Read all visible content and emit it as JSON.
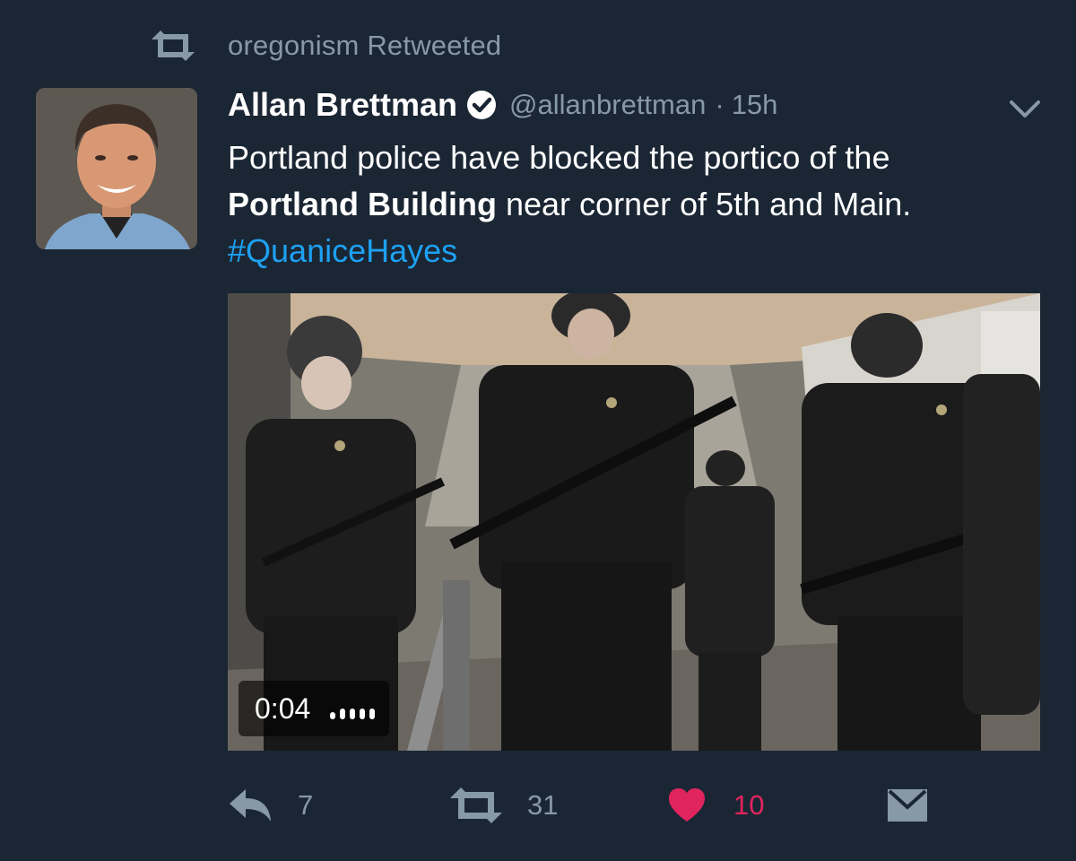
{
  "retweet_context": {
    "icon": "retweet-icon",
    "text": "oregonism Retweeted"
  },
  "author": {
    "avatar_alt": "Allan Brettman avatar",
    "display_name": "Allan Brettman",
    "verified_icon": "verified-badge-icon",
    "handle": "@allanbrettman",
    "separator": "·",
    "time": "15h"
  },
  "menu": {
    "icon": "chevron-down-icon"
  },
  "tweet": {
    "text_line1": "Portland police have blocked the portico of the",
    "text_bold": "Portland Building",
    "text_line2_rest": " near corner of 5th and Main.",
    "hashtag": "#QuaniceHayes"
  },
  "media": {
    "type": "video",
    "duration": "0:04",
    "signal_icon": "loading-dots-icon"
  },
  "actions": {
    "reply": {
      "icon": "reply-icon",
      "count": "7"
    },
    "retweet": {
      "icon": "retweet-icon",
      "count": "31"
    },
    "like": {
      "icon": "heart-icon",
      "count": "10",
      "active": true
    },
    "message": {
      "icon": "envelope-icon"
    }
  },
  "colors": {
    "background": "#1b2634",
    "text_primary": "#ffffff",
    "text_secondary": "#8899a6",
    "link": "#1da1f2",
    "like": "#e0245e"
  }
}
